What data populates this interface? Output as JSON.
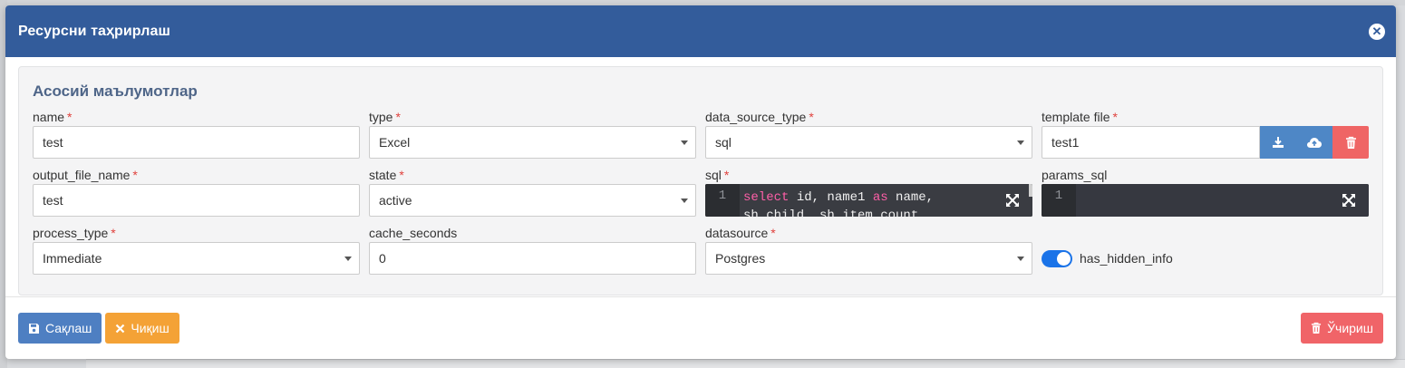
{
  "modal": {
    "title": "Ресурсни таҳрирлаш",
    "close_icon": "close-circle-icon"
  },
  "panel": {
    "title": "Асосий маълумотлар"
  },
  "fields": {
    "name": {
      "label": "name",
      "value": "test",
      "required": "*"
    },
    "type": {
      "label": "type",
      "value": "Excel",
      "required": "*"
    },
    "data_source_type": {
      "label": "data_source_type",
      "value": "sql",
      "required": "*"
    },
    "template_file": {
      "label": "template file",
      "value": "test1",
      "required": "*"
    },
    "output_file_name": {
      "label": "output_file_name",
      "value": "test",
      "required": "*"
    },
    "state": {
      "label": "state",
      "value": "active",
      "required": "*"
    },
    "sql": {
      "label": "sql",
      "required": "*",
      "line_number": "1",
      "kw1": "select",
      "code1a": " id, name1 ",
      "kw2": "as",
      "code1b": " name,",
      "line2": "sh_child, sh_item_count"
    },
    "params_sql": {
      "label": "params_sql",
      "line_number": "1"
    },
    "process_type": {
      "label": "process_type",
      "value": "Immediate",
      "required": "*"
    },
    "cache_seconds": {
      "label": "cache_seconds",
      "value": "0"
    },
    "datasource": {
      "label": "datasource",
      "value": "Postgres",
      "required": "*"
    },
    "has_hidden_info": {
      "label": "has_hidden_info",
      "checked": true
    }
  },
  "footer": {
    "save_label": "Сақлаш",
    "exit_label": "Чиқиш",
    "delete_label": "Ўчириш"
  },
  "colors": {
    "header": "#335c9b",
    "save": "#4e7fc2",
    "exit": "#f4a236",
    "delete": "#f06468",
    "toggle_on": "#1a73e8",
    "required": "#e0413d"
  }
}
